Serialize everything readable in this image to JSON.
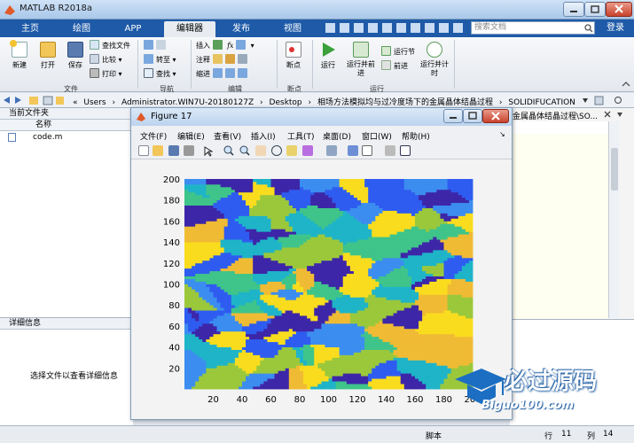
{
  "window": {
    "title": "MATLAB R2018a"
  },
  "tabs": [
    {
      "label": "主页"
    },
    {
      "label": "绘图"
    },
    {
      "label": "APP"
    },
    {
      "label": "编辑器"
    },
    {
      "label": "发布"
    },
    {
      "label": "视图"
    }
  ],
  "search": {
    "placeholder": "搜索文档"
  },
  "login": "登录",
  "ribbon": {
    "file": {
      "new": "新建",
      "open": "打开",
      "save": "保存",
      "find_files": "查找文件",
      "compare": "比较",
      "print": "打印",
      "group": "文件"
    },
    "nav": {
      "goto": "转至",
      "find": "查找",
      "group": "导航"
    },
    "edit": {
      "insert": "插入",
      "comment": "注释",
      "indent": "缩进",
      "fx": "fx",
      "group": "编辑"
    },
    "breakpoints": {
      "label": "断点",
      "group": "断点"
    },
    "run": {
      "run": "运行",
      "run_advance": "运行并前进",
      "run_section": "运行节",
      "advance": "前进",
      "run_time": "运行并计时",
      "group": "运行"
    }
  },
  "address": {
    "crumbs": [
      "«",
      "Users",
      "›",
      "Administrator.WIN7U-20180127Z",
      "›",
      "Desktop",
      "›",
      "相场方法模拟均与过冷度场下的金属晶体结晶过程",
      "›",
      "SOLIDIFUCATION"
    ]
  },
  "current_folder": {
    "title": "当前文件夹",
    "column": "名称",
    "files": [
      "code.m"
    ]
  },
  "details": {
    "title": "详细信息",
    "hint": "选择文件以查看详细信息"
  },
  "right_panel": {
    "title": "金属晶体结晶过程\\SO..."
  },
  "figure": {
    "title": "Figure 17",
    "menu": [
      "文件(F)",
      "编辑(E)",
      "查看(V)",
      "插入(I)",
      "工具(T)",
      "桌面(D)",
      "窗口(W)",
      "帮助(H)"
    ]
  },
  "status": {
    "script": "脚本",
    "row_label": "行",
    "row": "11",
    "col_label": "列",
    "col": "14"
  },
  "watermark": {
    "text": "必过源码",
    "url": "Biguo100.com"
  },
  "chart_data": {
    "type": "heatmap",
    "xlim": [
      0,
      200
    ],
    "ylim": [
      0,
      200
    ],
    "x_ticks": [
      20,
      40,
      60,
      80,
      100,
      120,
      140,
      160,
      180,
      200
    ],
    "y_ticks": [
      20,
      40,
      60,
      80,
      100,
      120,
      140,
      160,
      180,
      200
    ],
    "colormap": [
      "#3d26a8",
      "#2f5cf0",
      "#3c8df0",
      "#1fb4c8",
      "#3fc48a",
      "#9bc83b",
      "#f0bb34",
      "#fadc1e"
    ],
    "title": "",
    "xlabel": "",
    "ylabel": "",
    "grid": false
  }
}
